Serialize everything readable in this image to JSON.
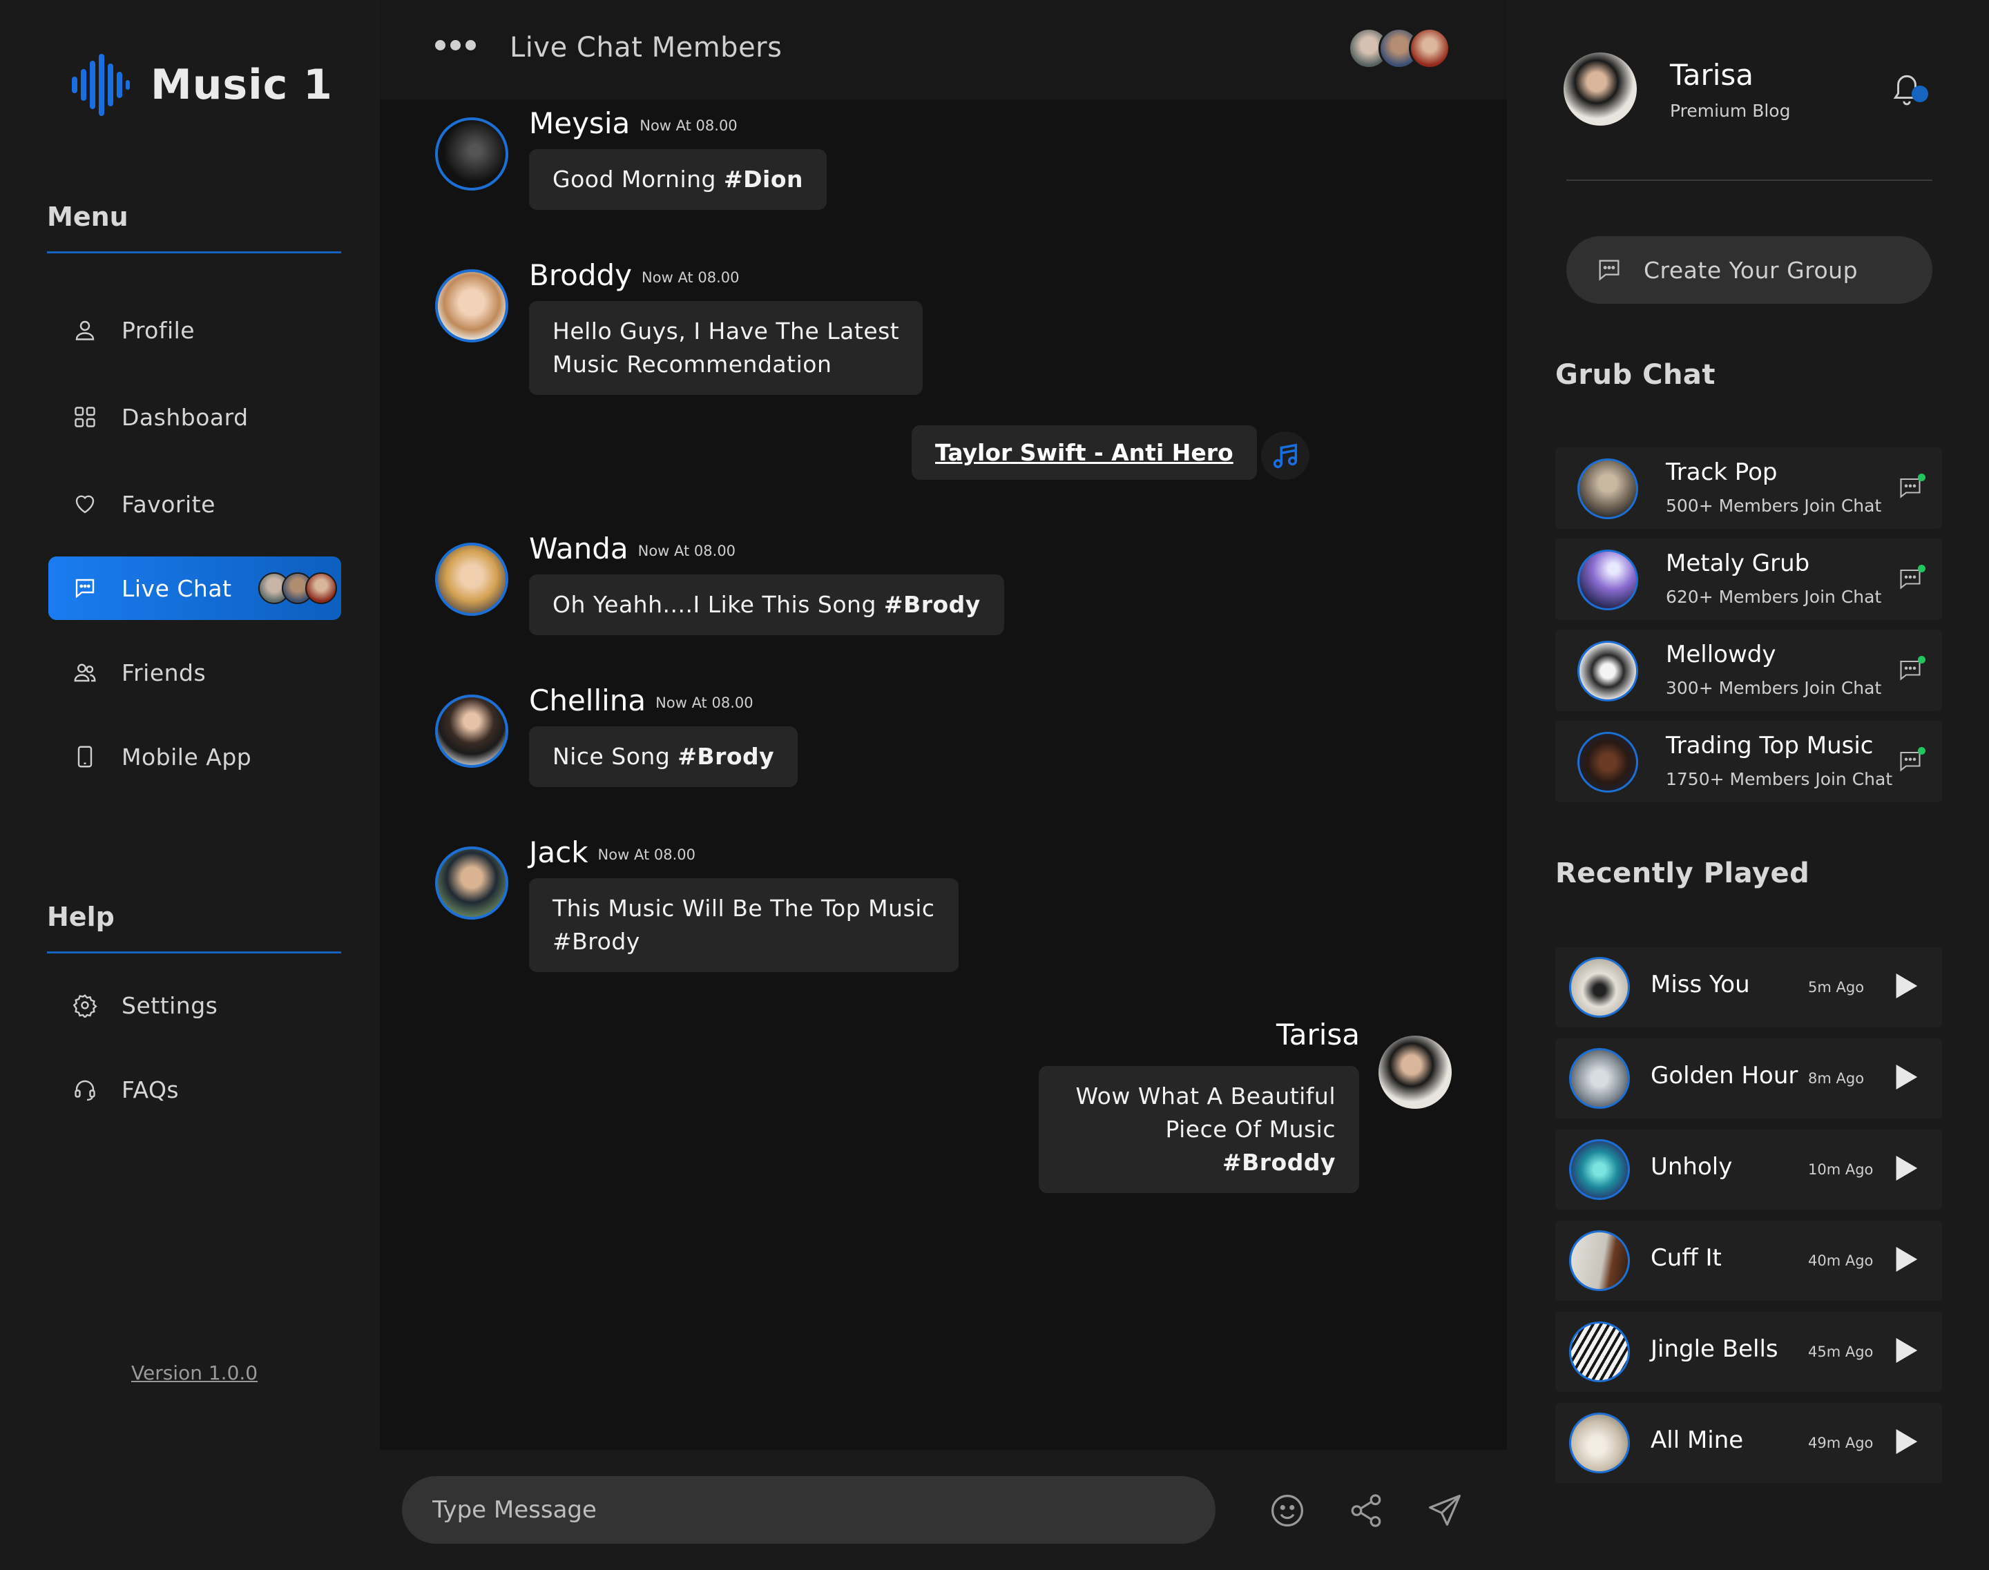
{
  "app": {
    "name": "Music 1",
    "version": "Version 1.0.0"
  },
  "menu": {
    "title": "Menu",
    "items": [
      {
        "label": "Profile",
        "icon": "user-icon"
      },
      {
        "label": "Dashboard",
        "icon": "grid-icon"
      },
      {
        "label": "Favorite",
        "icon": "heart-icon"
      },
      {
        "label": "Live Chat",
        "icon": "chat-icon",
        "active": true
      },
      {
        "label": "Friends",
        "icon": "friends-icon"
      },
      {
        "label": "Mobile App",
        "icon": "phone-icon"
      }
    ]
  },
  "help": {
    "title": "Help",
    "items": [
      {
        "label": "Settings",
        "icon": "gear-icon"
      },
      {
        "label": "FAQs",
        "icon": "headset-icon"
      }
    ]
  },
  "chat": {
    "title": "Live Chat Members",
    "messages": [
      {
        "name": "Meysia",
        "time": "Now At 08.00",
        "text": "Good Morning ",
        "tag": "#Dion"
      },
      {
        "name": "Broddy",
        "time": "Now At 08.00",
        "line1": "Hello Guys, I Have The Latest",
        "line2": "Music Recommendation"
      },
      {
        "name": "Wanda",
        "time": "Now At 08.00",
        "text": "Oh Yeahh....I Like This Song ",
        "tag": "#Brody"
      },
      {
        "name": "Chellina",
        "time": "Now At 08.00",
        "text": "Nice Song ",
        "tag": "#Brody"
      },
      {
        "name": "Jack",
        "time": "Now At 08.00",
        "line1": "This Music Will Be The Top Music",
        "line2": "#Brody"
      }
    ],
    "song_link": "Taylor Swift - Anti Hero",
    "me": {
      "name": "Tarisa",
      "line1": "Wow What A Beautiful",
      "line2": "Piece Of Music ",
      "tag": "#Broddy"
    },
    "input_placeholder": "Type Message"
  },
  "profile": {
    "name": "Tarisa",
    "subtitle": "Premium Blog"
  },
  "create_group": "Create Your Group",
  "groups": {
    "title": "Grub Chat",
    "items": [
      {
        "name": "Track Pop",
        "members": "500+ Members Join Chat"
      },
      {
        "name": "Metaly Grub",
        "members": "620+ Members Join Chat"
      },
      {
        "name": "Mellowdy",
        "members": "300+ Members Join Chat"
      },
      {
        "name": "Trading Top Music",
        "members": "1750+ Members Join Chat"
      }
    ]
  },
  "recent": {
    "title": "Recently Played",
    "items": [
      {
        "name": "Miss You",
        "time": "5m Ago"
      },
      {
        "name": "Golden Hour",
        "time": "8m Ago"
      },
      {
        "name": "Unholy",
        "time": "10m Ago"
      },
      {
        "name": "Cuff It",
        "time": "40m Ago"
      },
      {
        "name": "Jingle Bells",
        "time": "45m Ago"
      },
      {
        "name": "All Mine",
        "time": "49m Ago"
      }
    ]
  },
  "colors": {
    "accent": "#1a7cf0",
    "background": "#121212",
    "panel": "#1a1a1a",
    "online": "#22c55e"
  }
}
